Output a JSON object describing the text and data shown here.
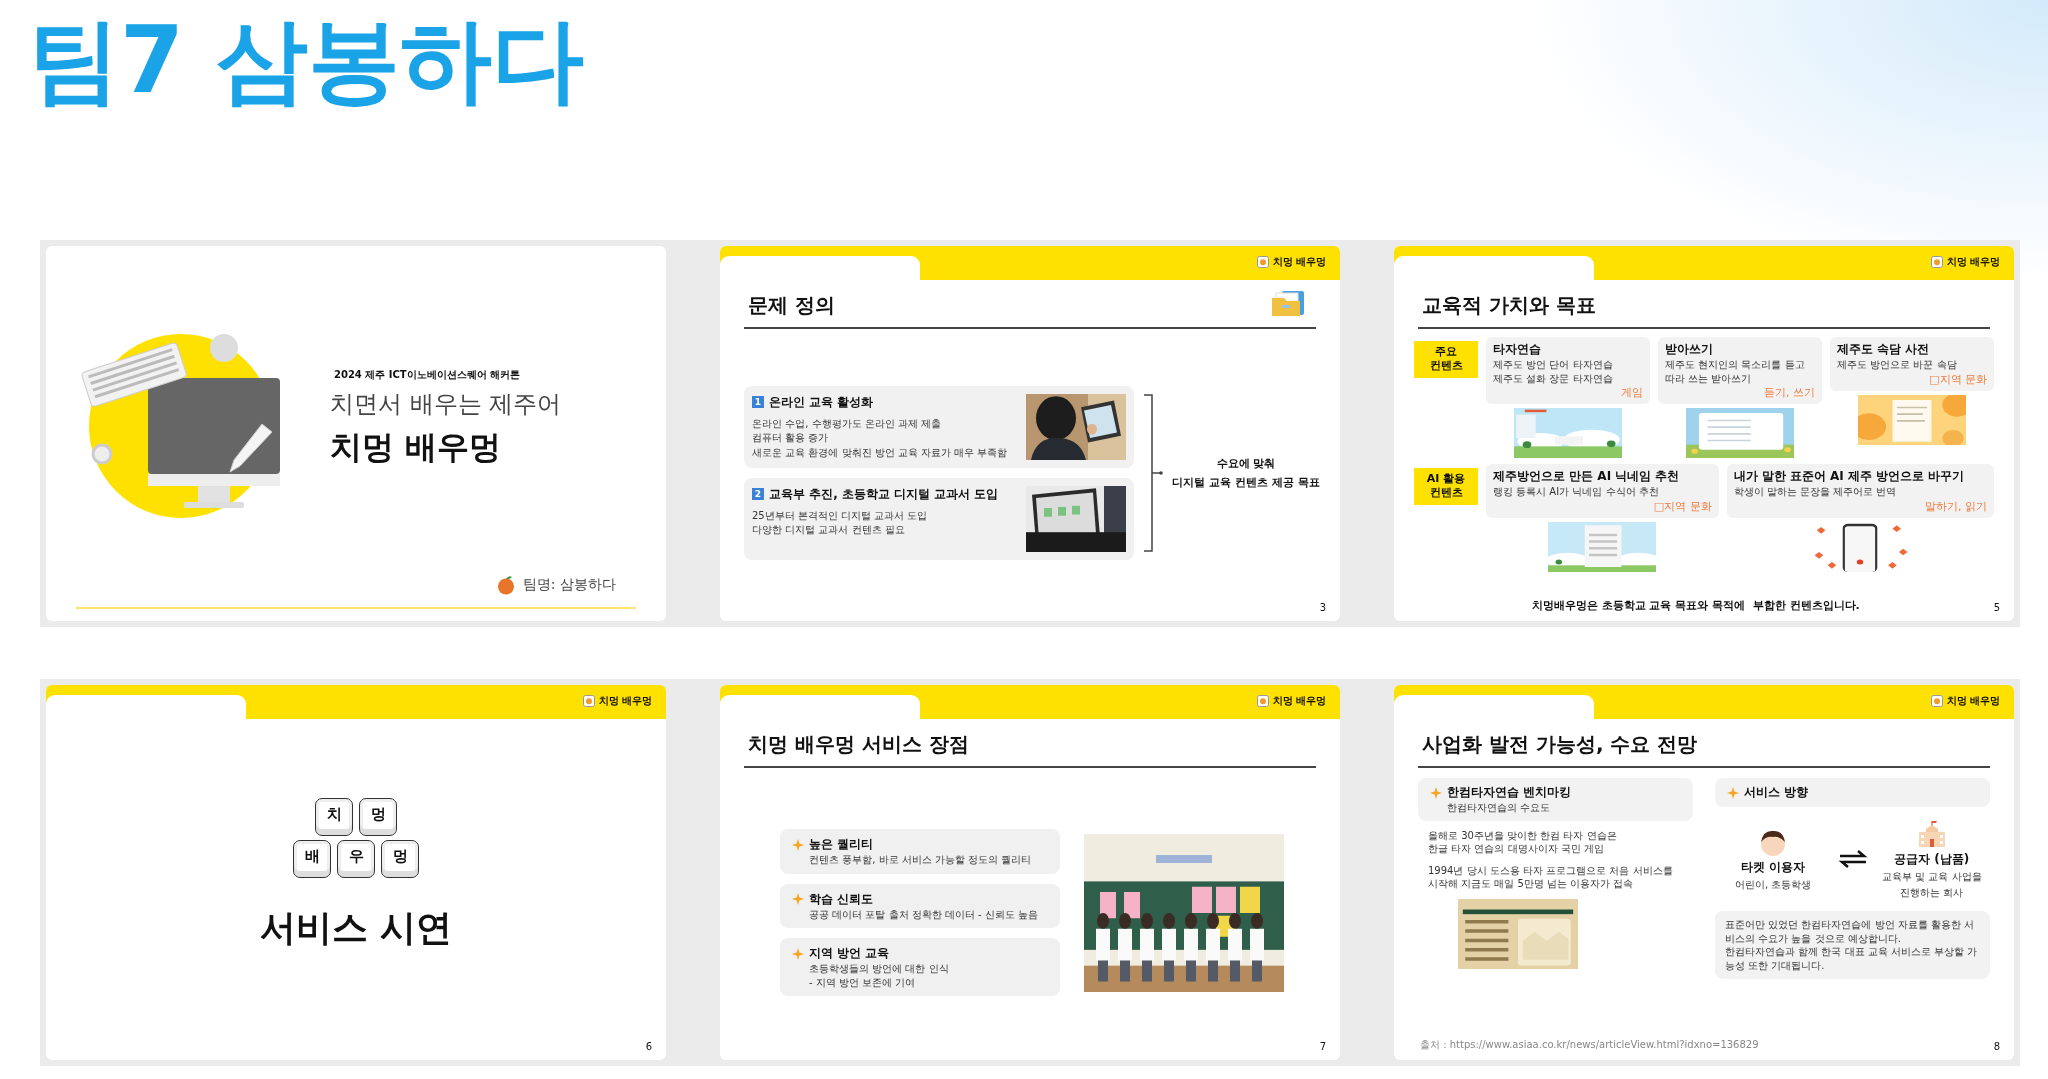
{
  "page_title": "팀7 삼봉하다",
  "slides": [
    {
      "kind": "cover",
      "event": "2024 제주 ICT이노베이션스퀘어 해커톤",
      "subtitle": "치면서 배우는 제주어",
      "title": "치멍 배우멍",
      "team": "팀명: 삼봉하다"
    },
    {
      "kind": "problem",
      "brand": "치멍 배우멍",
      "title": "문제 정의",
      "items": [
        {
          "number": "1",
          "heading": "온라인 교육 활성화",
          "lines": [
            "온라인 수업, 수행평가도 온라인 과제 제출",
            "컴퓨터 활용 증가",
            "새로운 교육 환경에 맞춰진 방언 교육 자료가 매우 부족함"
          ]
        },
        {
          "number": "2",
          "heading": "교육부 추진, 초등학교 디지털 교과서 도입",
          "lines": [
            "25년부터 본격적인 디지털 교과서 도입",
            "다양한 디지털 교과서 컨텐츠 필요"
          ]
        }
      ],
      "conclusion": [
        "수요에 맞춰",
        "디지털 교육 컨텐츠 제공 목표"
      ],
      "page": "3"
    },
    {
      "kind": "values",
      "brand": "치멍 배우멍",
      "title": "교육적 가치와 목표",
      "rows": [
        {
          "label": "주요 컨텐츠",
          "cards": [
            {
              "title": "타자연습",
              "lines": [
                "제주도 방언 단어 타자연습",
                "제주도 설화 장문 타자연습"
              ],
              "tag": "게임"
            },
            {
              "title": "받아쓰기",
              "lines": [
                "제주도 현지인의 목소리를 듣고",
                "따라 쓰는 받아쓰기"
              ],
              "tag": "듣기, 쓰기"
            },
            {
              "title": "제주도 속담 사전",
              "lines": [
                "제주도 방언으로 바꾼 속담"
              ],
              "tag": "□지역 문화"
            }
          ]
        },
        {
          "label": "AI 활용 컨텐츠",
          "cards": [
            {
              "title": "제주방언으로 만든 AI 닉네임 추천",
              "lines": [
                "랭킹 등록시 AI가 닉네임 수식어 추천"
              ],
              "tag": "□지역 문화"
            },
            {
              "title": "내가 말한 표준어 AI 제주 방언으로 바꾸기",
              "lines": [
                "학생이 말하는 문장을 제주어로 번역"
              ],
              "tag": "말하기, 읽기"
            }
          ]
        }
      ],
      "footer": "치멍배우멍은 초등학교 교육 목표와 목적에  부합한 컨텐츠입니다.",
      "page": "5"
    },
    {
      "kind": "section",
      "brand": "치멍 배우멍",
      "keys": [
        [
          "치",
          "멍"
        ],
        [
          "배",
          "우",
          "멍"
        ]
      ],
      "title": "서비스 시연",
      "page": "6"
    },
    {
      "kind": "features",
      "brand": "치멍 배우멍",
      "title": "치멍 배우멍 서비스 장점",
      "items": [
        {
          "heading": "높은 퀄리티",
          "lines": [
            "컨텐츠 풍부함, 바로 서비스 가능할 정도의 퀄리티"
          ]
        },
        {
          "heading": "학습 신뢰도",
          "lines": [
            "공공 데이터 포탈 출처 정확한 데이터 - 신뢰도 높음"
          ]
        },
        {
          "heading": "지역 방언 교육",
          "lines": [
            "초등학생들의 방언에 대한 인식",
            "- 지역 방언 보존에 기여"
          ]
        }
      ],
      "page": "7"
    },
    {
      "kind": "business",
      "brand": "치멍 배우멍",
      "title": "사업화 발전 가능성, 수요 전망",
      "benchmark": {
        "heading": "한컴타자연습 벤치마킹",
        "sub": "한컴타자연습의 수요도",
        "paragraphs": [
          [
            "올해로 30주년을 맞이한 한컴 타자 연습은",
            "한글 타자 연습의 대명사이자 국민 게임"
          ],
          [
            "1994년 당시 도스용 타자 프로그램으로 처음 서비스를",
            "시작해 지금도 매일 5만명 넘는 이용자가 접속"
          ]
        ],
        "source": "출처 : https://www.asiaa.co.kr/news/articleView.html?idxno=136829"
      },
      "direction": {
        "heading": "서비스 방향",
        "roles": [
          {
            "kind": "user",
            "title": "타켓 이용자",
            "lines": [
              "어린이, 초등학생"
            ]
          },
          {
            "kind": "supplier",
            "title": "공급자 (납품)",
            "lines": [
              "교육부 및 교육 사업을",
              "진행하는 회사"
            ]
          }
        ],
        "summary": [
          "표준어만 있었던 한컴타자연습에 방언 자료를 활용한 서비스의 수요가 높을 것으로 예상합니다.",
          "한컴타자연습과 함께 한국 대표 교육 서비스로 부상할 가능성 또한 기대됩니다."
        ]
      },
      "page": "8"
    }
  ]
}
